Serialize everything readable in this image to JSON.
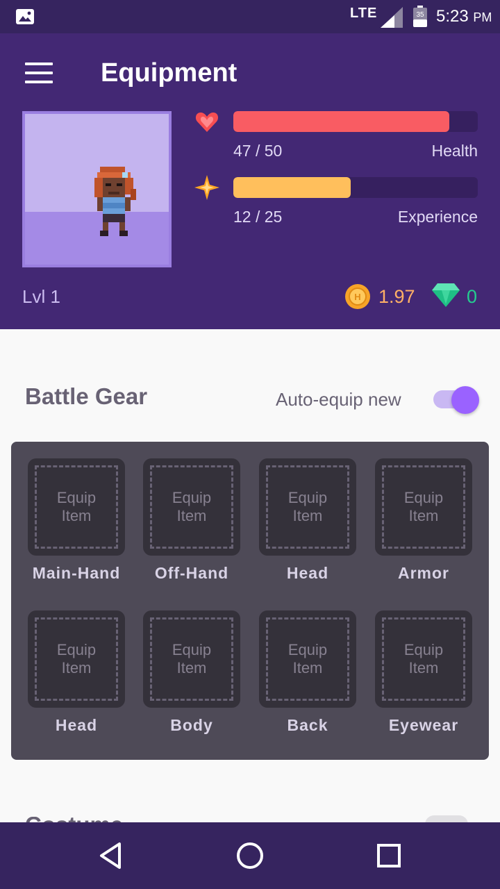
{
  "status_bar": {
    "network": "LTE",
    "battery_level": "35",
    "time": "5:23",
    "ampm": "PM",
    "icons": [
      "gallery-icon",
      "signal-icon",
      "battery-icon"
    ]
  },
  "header": {
    "title": "Equipment",
    "menu_icon": "hamburger-menu-icon"
  },
  "stats": {
    "health": {
      "current_text": "47 / 50",
      "label": "Health",
      "value": 47,
      "max": 50,
      "color": "#f95c63"
    },
    "experience": {
      "current_text": "12 / 25",
      "label": "Experience",
      "value": 12,
      "max": 25,
      "color": "#ffbf5c"
    }
  },
  "player": {
    "level": "Lvl 1",
    "gold": "1.97",
    "gems": "0"
  },
  "battle_gear": {
    "title": "Battle Gear",
    "auto_equip_label": "Auto-equip new",
    "auto_equip_on": true,
    "slots": [
      {
        "placeholder_line1": "Equip",
        "placeholder_line2": "Item",
        "label": "Main-Hand"
      },
      {
        "placeholder_line1": "Equip",
        "placeholder_line2": "Item",
        "label": "Off-Hand"
      },
      {
        "placeholder_line1": "Equip",
        "placeholder_line2": "Item",
        "label": "Head"
      },
      {
        "placeholder_line1": "Equip",
        "placeholder_line2": "Item",
        "label": "Armor"
      },
      {
        "placeholder_line1": "Equip",
        "placeholder_line2": "Item",
        "label": "Head"
      },
      {
        "placeholder_line1": "Equip",
        "placeholder_line2": "Item",
        "label": "Body"
      },
      {
        "placeholder_line1": "Equip",
        "placeholder_line2": "Item",
        "label": "Back"
      },
      {
        "placeholder_line1": "Equip",
        "placeholder_line2": "Item",
        "label": "Eyewear"
      }
    ]
  },
  "next_section": {
    "title": "Costume"
  },
  "colors": {
    "header_bg": "#432874",
    "status_bg": "#36245f",
    "accent": "#9a62ff",
    "gold": "#ffb066",
    "gem": "#24cc8f"
  }
}
